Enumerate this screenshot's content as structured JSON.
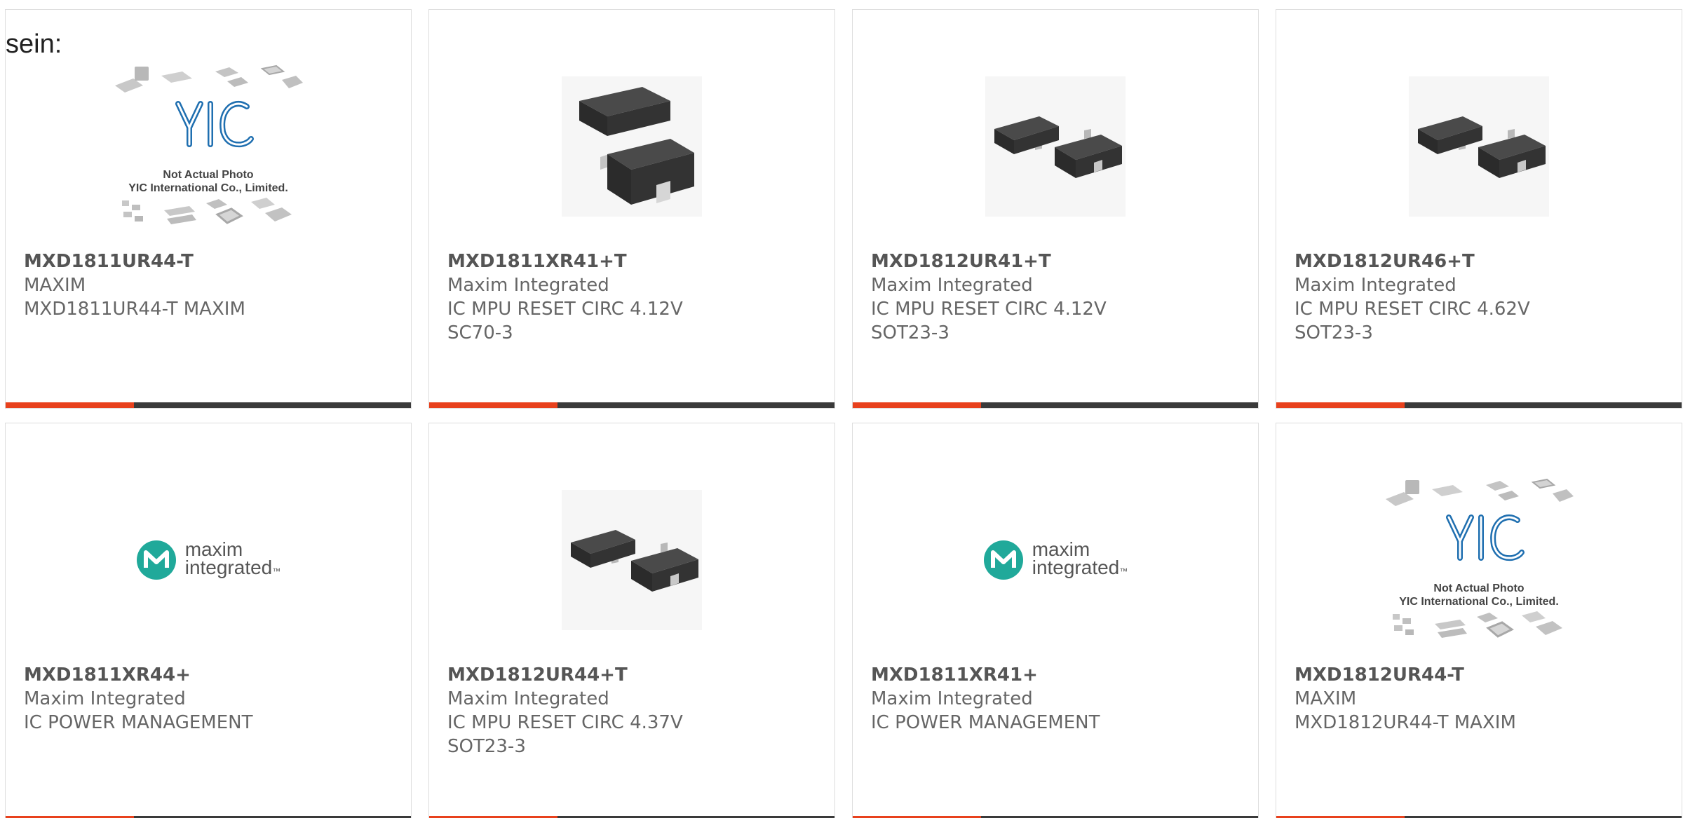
{
  "intro_text": "sein:",
  "accent_color": "#e8411d",
  "bar_color": "#3a3a3a",
  "logo_color": "#20a99a",
  "yic_caption": {
    "line1": "Not Actual Photo",
    "line2": "YIC International Co., Limited."
  },
  "maxim_logo_text": {
    "line1": "maxim",
    "line2": "integrated",
    "tm": "™"
  },
  "products": [
    {
      "part_number": "MXD1811UR44-T",
      "manufacturer": "MAXIM",
      "description": "MXD1811UR44-T MAXIM",
      "image": "yic-placeholder"
    },
    {
      "part_number": "MXD1811XR41+T",
      "manufacturer": "Maxim Integrated",
      "description": "IC MPU RESET CIRC 4.12V SC70-3",
      "image": "sc70-chip-photo"
    },
    {
      "part_number": "MXD1812UR41+T",
      "manufacturer": "Maxim Integrated",
      "description": "IC MPU RESET CIRC 4.12V SOT23-3",
      "image": "sot23-chip-photo"
    },
    {
      "part_number": "MXD1812UR46+T",
      "manufacturer": "Maxim Integrated",
      "description": "IC MPU RESET CIRC 4.62V SOT23-3",
      "image": "sot23-chip-photo"
    },
    {
      "part_number": "MXD1811XR44+",
      "manufacturer": "Maxim Integrated",
      "description": "IC POWER MANAGEMENT",
      "image": "maxim-integrated-logo"
    },
    {
      "part_number": "MXD1812UR44+T",
      "manufacturer": "Maxim Integrated",
      "description": "IC MPU RESET CIRC 4.37V SOT23-3",
      "image": "sot23-chip-photo"
    },
    {
      "part_number": "MXD1811XR41+",
      "manufacturer": "Maxim Integrated",
      "description": "IC POWER MANAGEMENT",
      "image": "maxim-integrated-logo"
    },
    {
      "part_number": "MXD1812UR44-T",
      "manufacturer": "MAXIM",
      "description": "MXD1812UR44-T MAXIM",
      "image": "yic-placeholder"
    }
  ]
}
